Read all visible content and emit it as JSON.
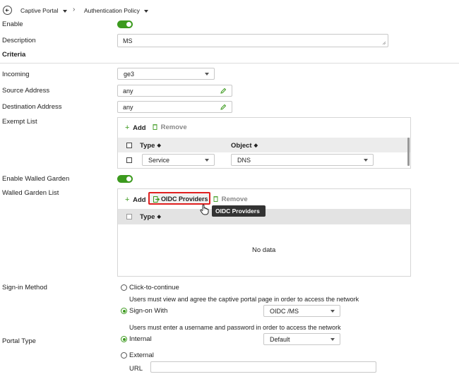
{
  "breadcrumb": {
    "item1": "Captive Portal",
    "item2": "Authentication Policy"
  },
  "fields": {
    "enable_label": "Enable",
    "description_label": "Description",
    "description_value": "MS",
    "criteria_heading": "Criteria",
    "incoming_label": "Incoming",
    "incoming_value": "ge3",
    "source_label": "Source Address",
    "source_value": "any",
    "destination_label": "Destination Address",
    "destination_value": "any",
    "exempt_label": "Exempt List",
    "walled_garden_enable_label": "Enable Walled Garden",
    "walled_garden_list_label": "Walled Garden List",
    "signin_label": "Sign-in Method",
    "portal_type_label": "Portal Type"
  },
  "exempt": {
    "add_label": "Add",
    "remove_label": "Remove",
    "col_type": "Type",
    "col_object": "Object",
    "rows": [
      {
        "type": "Service",
        "object": "DNS"
      }
    ]
  },
  "walled": {
    "add_label": "Add",
    "oidc_label": "OIDC Providers",
    "remove_label": "Remove",
    "col_type": "Type",
    "empty": "No data",
    "tooltip": "OIDC Providers"
  },
  "signin": {
    "click_to_continue": "Click-to-continue",
    "click_help": "Users must view and agree the captive portal page in order to access the network",
    "sign_on_with": "Sign-on With",
    "sign_on_value": "OIDC /MS",
    "sign_on_help": "Users must enter a username and password in order to access the network"
  },
  "portal": {
    "internal": "Internal",
    "internal_value": "Default",
    "external": "External",
    "url_label": "URL",
    "url_value": ""
  },
  "colors": {
    "accent": "#3c9a1e",
    "highlight": "#e02020",
    "tooltip_bg": "#333333"
  }
}
